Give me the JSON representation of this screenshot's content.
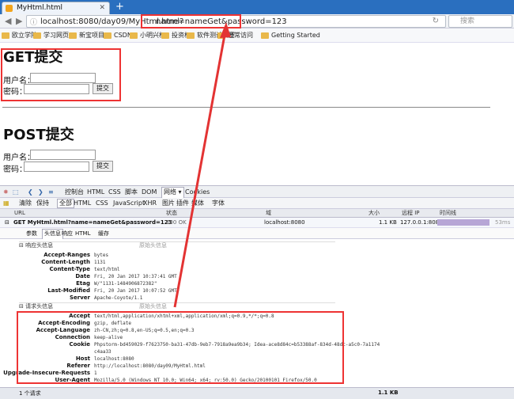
{
  "browser": {
    "tab_title": "MyHtml.html",
    "new_tab": "+",
    "url_base": "localhost:8080/day09/MyHtml.html?",
    "url_query": "name=nameGet&password=123",
    "search_placeholder": "搜索",
    "bookmarks": [
      "欧立学院",
      "学习网页",
      "新宝项目",
      "CSDN",
      "小明兴杯",
      "投资杯",
      "软件测试大赛",
      "经常访问",
      "Getting Started"
    ]
  },
  "page": {
    "get_title": "GET提交",
    "post_title": "POST提交",
    "username_label": "用户名：",
    "password_label": "密码：",
    "submit_label": "提交"
  },
  "firebug": {
    "toolbar": [
      "控制台",
      "HTML",
      "CSS",
      "脚本",
      "DOM",
      "网络 ▾",
      "Cookies"
    ],
    "subbar": [
      "清除",
      "保持",
      "全部",
      "HTML",
      "CSS",
      "JavaScript",
      "XHR",
      "图片",
      "插件",
      "媒体",
      "字体"
    ],
    "columns": [
      "URL",
      "状态",
      "域",
      "大小",
      "远程 IP",
      "时间线"
    ],
    "request": {
      "method_url": "GET MyHtml.html?name=nameGet&password=123",
      "status": "200 OK",
      "domain": "localhost:8080",
      "size": "1.1 KB",
      "remote_ip": "127.0.0.1:8080",
      "time": "53ms"
    },
    "detail_tabs": [
      "参数",
      "头信息",
      "响应",
      "HTML",
      "缓存"
    ],
    "response_section": "响应头信息",
    "request_section": "请求头信息",
    "source_label": "原始头信息",
    "response_headers": [
      {
        "k": "Accept-Ranges",
        "v": "bytes"
      },
      {
        "k": "Content-Length",
        "v": "1131"
      },
      {
        "k": "Content-Type",
        "v": "text/html"
      },
      {
        "k": "Date",
        "v": "Fri, 20 Jan 2017 10:37:41 GMT"
      },
      {
        "k": "Etag",
        "v": "W/\"1131-1484906872382\""
      },
      {
        "k": "Last-Modified",
        "v": "Fri, 20 Jan 2017 10:07:52 GMT"
      },
      {
        "k": "Server",
        "v": "Apache-Coyote/1.1"
      }
    ],
    "request_headers": [
      {
        "k": "Accept",
        "v": "text/html,application/xhtml+xml,application/xml;q=0.9,*/*;q=0.8"
      },
      {
        "k": "Accept-Encoding",
        "v": "gzip, deflate"
      },
      {
        "k": "Accept-Language",
        "v": "zh-CN,zh;q=0.8,en-US;q=0.5,en;q=0.3"
      },
      {
        "k": "Connection",
        "v": "keep-alive"
      },
      {
        "k": "Cookie",
        "v": "Phpstorm-bd459029-f7623750-ba31-47db-9eb7-7918a9ea9b34; Idea-ace8d84c=b53388af-834d-48dc-a5c0-7a1174"
      },
      {
        "k": "",
        "v": "c4aa33"
      },
      {
        "k": "Host",
        "v": "localhost:8080"
      },
      {
        "k": "Referer",
        "v": "http://localhost:8080/day09/MyHtml.html"
      },
      {
        "k": "Upgrade-Insecure-Requests",
        "v": "1"
      },
      {
        "k": "User-Agent",
        "v": "Mozilla/5.0 (Windows NT 10.0; Win64; x64; rv:50.0) Gecko/20100101 Firefox/50.0"
      }
    ],
    "status_left": "1 个请求",
    "status_right": "1.1 KB"
  },
  "colors": {
    "annotation": "#e33333",
    "timeline": "#b7a6d6",
    "tabbar": "#2a6fbf"
  }
}
